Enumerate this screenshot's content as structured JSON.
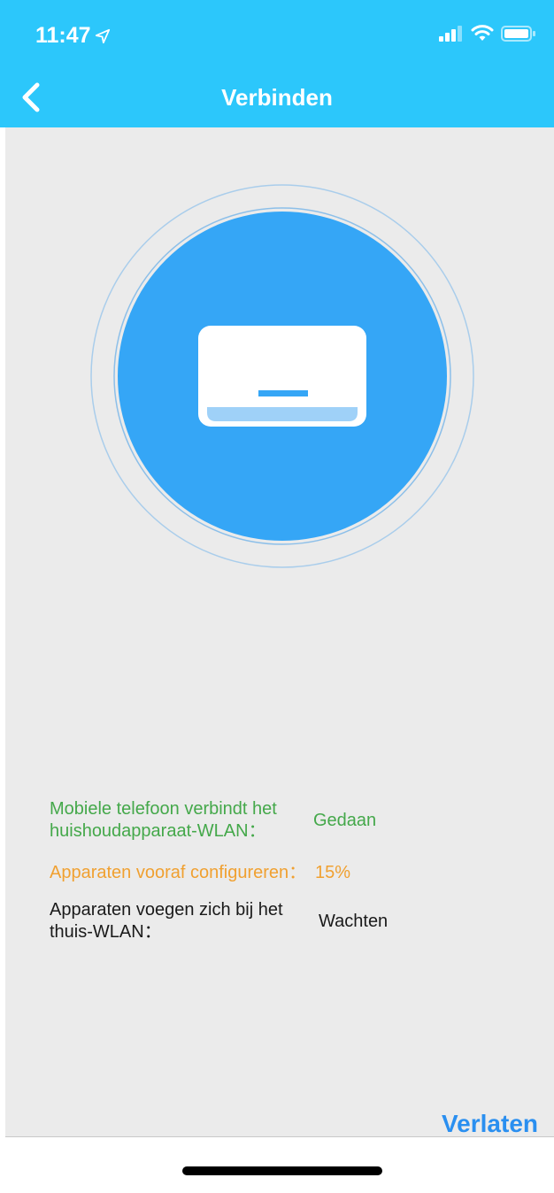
{
  "status_bar": {
    "time": "11:47"
  },
  "header": {
    "title": "Verbinden",
    "color": "#2cc7fb"
  },
  "steps": [
    {
      "label": "Mobiele telefoon verbindt het huishoudapparaat-WLAN：",
      "value": "Gedaan",
      "color": "#44a84a"
    },
    {
      "label": "Apparaten vooraf configureren：",
      "value": "15%",
      "color": "#f0a030"
    },
    {
      "label": "Apparaten voegen zich bij het thuis-WLAN：",
      "value": "Wachten",
      "color": "#1a1a1a"
    }
  ],
  "footer": {
    "exit_label": "Verlaten"
  },
  "icons": [
    "location-arrow-icon",
    "signal-icon",
    "wifi-icon",
    "battery-icon",
    "back-chevron-icon",
    "air-conditioner-icon"
  ]
}
